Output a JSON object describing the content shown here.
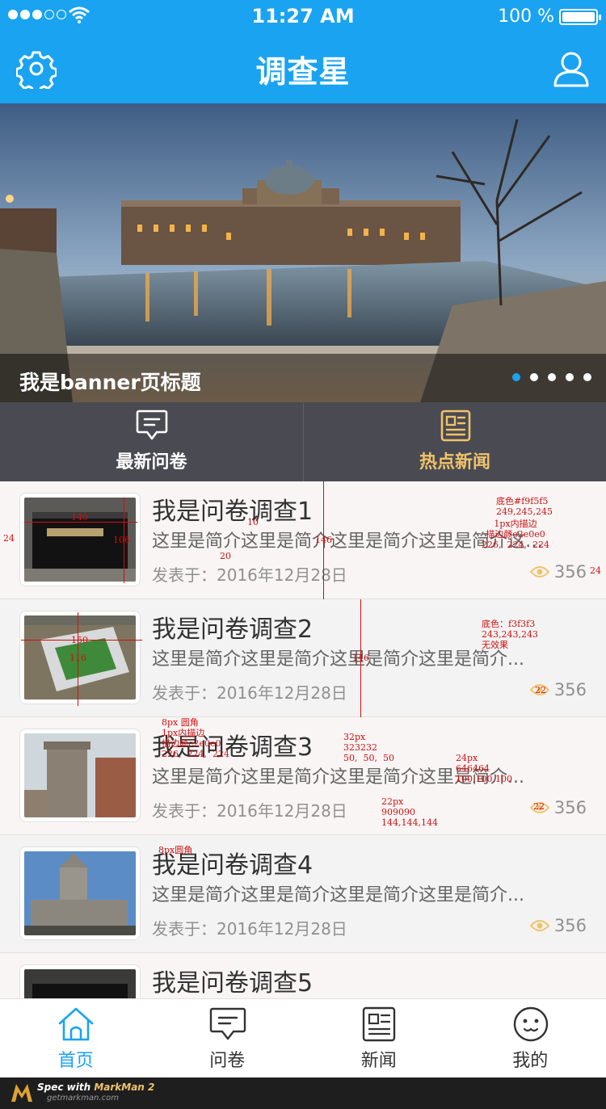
{
  "status_bar": {
    "time": "11:27 AM",
    "battery_text": "100 %"
  },
  "nav": {
    "title": "调查星",
    "left_icon": "gear-icon",
    "right_icon": "user-icon"
  },
  "banner": {
    "title": "我是banner页标题",
    "dots": 5,
    "active_dot": 0
  },
  "segments": [
    {
      "label": "最新问卷",
      "icon": "message-icon",
      "active": false
    },
    {
      "label": "热点新闻",
      "icon": "news-icon",
      "active": true
    }
  ],
  "list": [
    {
      "title": "我是问卷调查1",
      "intro": "这里是简介这里是简介这里是简介这里是简介这里是简介",
      "date": "发表于：2016年12月28日",
      "views": "356"
    },
    {
      "title": "我是问卷调查2",
      "intro": "这里是简介这里是简介这里是简介这里是简介...",
      "date": "发表于：2016年12月28日",
      "views": "356"
    },
    {
      "title": "我是问卷调查3",
      "intro": "这里是简介这里是简介这里是简介这里是简介...",
      "date": "发表于：2016年12月28日",
      "views": "356"
    },
    {
      "title": "我是问卷调查4",
      "intro": "这里是简介这里是简介这里是简介这里是简介...",
      "date": "发表于：2016年12月28日",
      "views": "356"
    },
    {
      "title": "我是问卷调查5",
      "intro": "",
      "date": "",
      "views": ""
    }
  ],
  "tabbar": [
    {
      "label": "首页",
      "icon": "home-icon",
      "active": true
    },
    {
      "label": "问卷",
      "icon": "message-icon",
      "active": false
    },
    {
      "label": "新闻",
      "icon": "news-icon",
      "active": false
    },
    {
      "label": "我的",
      "icon": "smiley-icon",
      "active": false
    }
  ],
  "footer": {
    "brand_prefix": "Spec with",
    "brand": "MarkMan 2",
    "url": "getmarkman.com"
  },
  "annotations": {
    "a1": "底色#f9f5f5\n249,245,245",
    "a2": "1px内描边\n描边颜e2e0e0\n226,  224,  224",
    "a3": "底色：f3f3f3\n243,243,243\n无效果",
    "a4": "8px 圆角\n1px内描边\n描边颜e2e0e0\n226,  224,  224",
    "a5": "32px\n323232\n50,  50,  50",
    "a6": "24px\n646464\n100,100,100",
    "a7": "22px\n909090\n144,144,144",
    "a8": "8px圆角",
    "m140": "140",
    "m106": "106",
    "m150": "150",
    "m116": "116",
    "m10": "10",
    "m20": "20",
    "m146a": "146",
    "m146b": "146",
    "m24l": "24",
    "m24r": "24",
    "m22a": "22",
    "m22b": "22"
  },
  "colors": {
    "primary": "#1aa3f1",
    "segment_bg": "#4a4a52",
    "active_gold": "#f0c36a",
    "row_odd": "#f9f5f5",
    "row_even": "#f3f3f3",
    "border": "#e2e0e0"
  }
}
